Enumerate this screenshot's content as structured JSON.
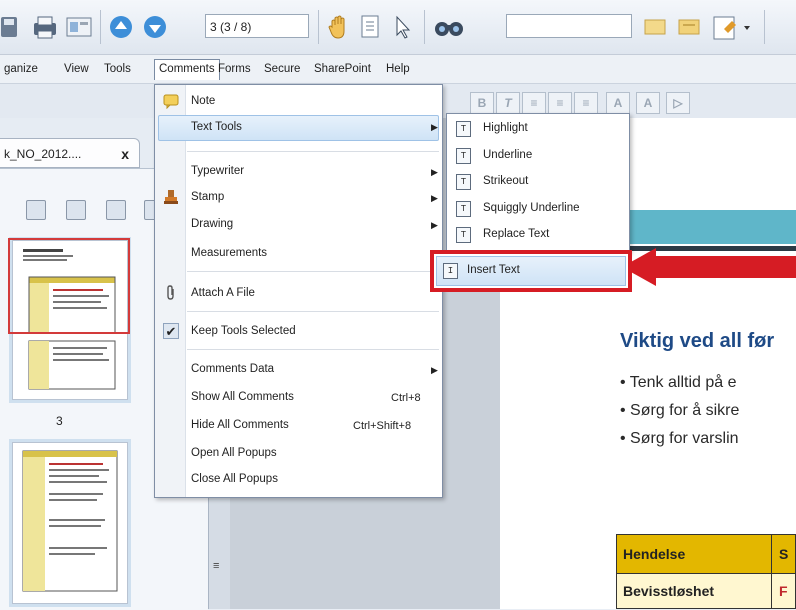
{
  "toolbar": {
    "page_indicator": "3 (3 / 8)",
    "icons": [
      "save-icon",
      "print-icon",
      "view-icon",
      "prev-page-icon",
      "next-page-icon",
      "hand-tool-icon",
      "select-text-icon",
      "select-icon",
      "find-icon",
      "highlight-icon",
      "comment-icon",
      "stamp-icon"
    ]
  },
  "menubar": {
    "items": [
      "ganize",
      "View",
      "Tools",
      "Comments",
      "Forms",
      "Secure",
      "SharePoint",
      "Help"
    ],
    "active": "Comments"
  },
  "document_tab": {
    "label": "k_NO_2012....",
    "close": "x"
  },
  "thumbnails": {
    "page_label": "3"
  },
  "comments_menu": {
    "items": [
      {
        "label": "Note",
        "icon": "note-icon"
      },
      {
        "label": "Text Tools",
        "submenu": true,
        "highlighted": true
      },
      {
        "label": "Typewriter",
        "submenu": true
      },
      {
        "label": "Stamp",
        "icon": "stamp-icon",
        "submenu": true
      },
      {
        "label": "Drawing",
        "submenu": true
      },
      {
        "label": "Measurements"
      },
      {
        "label": "Attach A File",
        "icon": "paperclip-icon"
      },
      {
        "label": "Keep Tools Selected",
        "icon": "checkmark-icon"
      },
      {
        "label": "Comments Data",
        "submenu": true
      },
      {
        "label": "Show All Comments",
        "shortcut": "Ctrl+8"
      },
      {
        "label": "Hide All Comments",
        "shortcut": "Ctrl+Shift+8"
      },
      {
        "label": "Open All Popups"
      },
      {
        "label": "Close All Popups"
      }
    ]
  },
  "text_tools_submenu": {
    "items": [
      "Highlight",
      "Underline",
      "Strikeout",
      "Squiggly Underline",
      "Replace Text",
      "Insert Text"
    ],
    "highlighted": "Insert Text"
  },
  "document": {
    "heading": "Viktig ved all før",
    "bullets": [
      "• Tenk alltid på e",
      "• Sørg for å sikre",
      "• Sørg for varslin"
    ],
    "table": {
      "header": [
        "Hendelse",
        "S"
      ],
      "row": [
        "Bevisstløshet",
        "F"
      ]
    }
  },
  "colors": {
    "annotation_red": "#d61c24",
    "menu_highlight": "#cfe3f6",
    "doc_heading": "#1e4a86",
    "table_header": "#e3b700",
    "banner_teal": "#5fb6c9"
  }
}
